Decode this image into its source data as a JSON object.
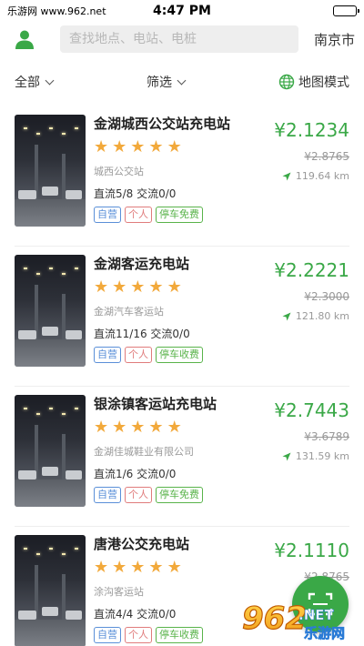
{
  "status_bar": {
    "site": "乐游网 www.962.net",
    "time": "4:47 PM"
  },
  "search": {
    "placeholder": "查找地点、电站、电桩",
    "city": "南京市"
  },
  "filters": {
    "all": "全部",
    "filter": "筛选",
    "map_mode": "地图模式"
  },
  "stations": [
    {
      "name": "金湖城西公交站充电站",
      "stars": 5,
      "address": "城西公交站",
      "ports": "直流5/8  交流0/0",
      "price": "¥2.1234",
      "original_price": "¥2.8765",
      "distance": "119.64 km",
      "tags": [
        "自营",
        "个人",
        "停车免费"
      ]
    },
    {
      "name": "金湖客运充电站",
      "stars": 5,
      "address": "金湖汽车客运站",
      "ports": "直流11/16  交流0/0",
      "price": "¥2.2221",
      "original_price": "¥2.3000",
      "distance": "121.80 km",
      "tags": [
        "自营",
        "个人",
        "停车收费"
      ]
    },
    {
      "name": "银涂镇客运站充电站",
      "stars": 5,
      "address": "金湖佳城鞋业有限公司",
      "ports": "直流1/6  交流0/0",
      "price": "¥2.7443",
      "original_price": "¥3.6789",
      "distance": "131.59 km",
      "tags": [
        "自营",
        "个人",
        "停车免费"
      ]
    },
    {
      "name": "唐港公交充电站",
      "stars": 5,
      "address": "涂沟客运站",
      "ports": "直流4/4  交流0/0",
      "price": "¥2.1110",
      "original_price": "¥2.8765",
      "distance": "",
      "tags": [
        "自营",
        "个人",
        "停车收费"
      ]
    }
  ],
  "watermark": {
    "text": "962",
    "sub": "乐游网"
  },
  "colors": {
    "accent": "#3aa847",
    "star": "#f2a93b",
    "tag_self": "#5a8fd8",
    "tag_person": "#e07c7c",
    "tag_park": "#59b34a"
  },
  "icons": {
    "user": "user-icon",
    "globe": "globe-icon",
    "location": "location-arrow-icon",
    "scan": "scan-icon"
  }
}
